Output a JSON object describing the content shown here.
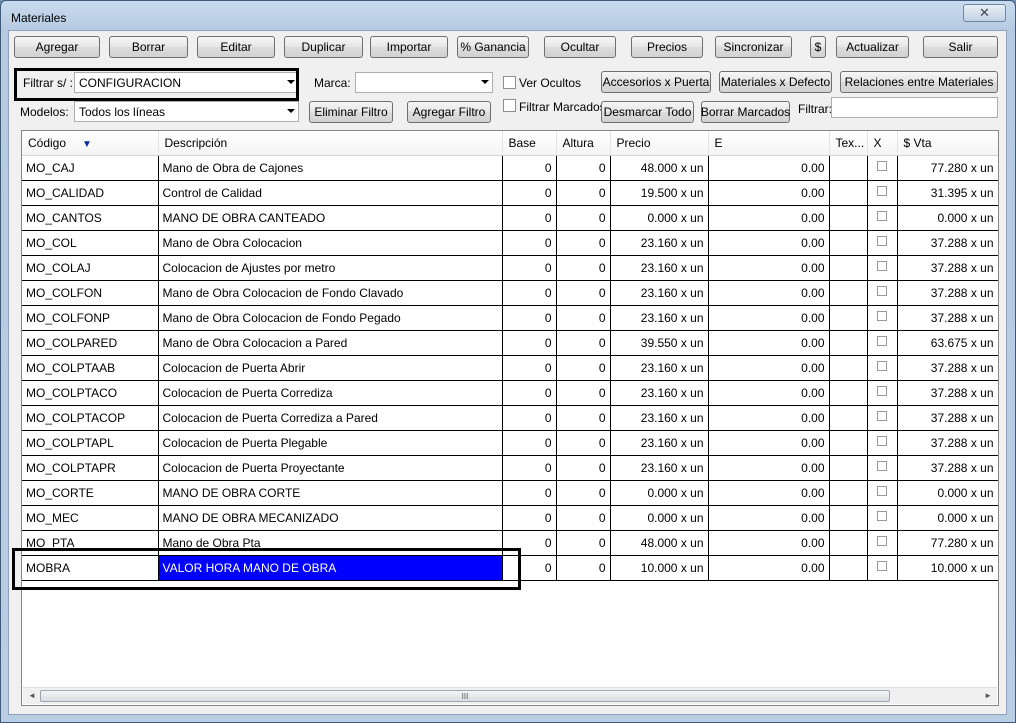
{
  "window": {
    "title": "Materiales",
    "close_glyph": "✕"
  },
  "toolbar": {
    "buttons": [
      "Agregar",
      "Borrar",
      "Editar",
      "Duplicar",
      "Importar",
      "% Ganancia",
      "Ocultar",
      "Precios",
      "Sincronizar",
      "$",
      "Actualizar",
      "Salir"
    ]
  },
  "filters": {
    "filtrar_label": "Filtrar s/ :",
    "filtrar_value": "CONFIGURACION",
    "marca_label": "Marca:",
    "marca_value": "",
    "modelos_label": "Modelos:",
    "modelos_value": "Todos los líneas",
    "ver_ocultos": "Ver Ocultos",
    "filtrar_marcados": "Filtrar Marcados",
    "eliminar_filtro": "Eliminar Filtro",
    "agregar_filtro": "Agregar Filtro",
    "accesorios_puerta": "Accesorios x Puerta",
    "materiales_defecto": "Materiales x Defecto",
    "relaciones": "Relaciones entre Materiales",
    "desmarcar_todo": "Desmarcar Todo",
    "borrar_marcados": "Borrar Marcados",
    "filtrar_text_label": "Filtrar:"
  },
  "table": {
    "headers": [
      "Código",
      "Descripción",
      "Base",
      "Altura",
      "Precio",
      "E",
      "Tex...",
      "X",
      "$ Vta"
    ],
    "sort_glyph": "▼",
    "rows": [
      {
        "codigo": "MO_CAJ",
        "descripcion": "Mano de Obra de Cajones",
        "base": "0",
        "altura": "0",
        "precio": "48.000 x un",
        "e": "0.00",
        "vta": "77.280 x un"
      },
      {
        "codigo": "MO_CALIDAD",
        "descripcion": "Control de Calidad",
        "base": "0",
        "altura": "0",
        "precio": "19.500 x un",
        "e": "0.00",
        "vta": "31.395 x un"
      },
      {
        "codigo": "MO_CANTOS",
        "descripcion": "MANO DE OBRA CANTEADO",
        "base": "0",
        "altura": "0",
        "precio": "0.000 x un",
        "e": "0.00",
        "vta": "0.000 x un"
      },
      {
        "codigo": "MO_COL",
        "descripcion": "Mano de Obra Colocacion",
        "base": "0",
        "altura": "0",
        "precio": "23.160 x un",
        "e": "0.00",
        "vta": "37.288 x un"
      },
      {
        "codigo": "MO_COLAJ",
        "descripcion": "Colocacion de Ajustes por metro",
        "base": "0",
        "altura": "0",
        "precio": "23.160 x un",
        "e": "0.00",
        "vta": "37.288 x un"
      },
      {
        "codigo": "MO_COLFON",
        "descripcion": "Mano de Obra Colocacion de Fondo Clavado",
        "base": "0",
        "altura": "0",
        "precio": "23.160 x un",
        "e": "0.00",
        "vta": "37.288 x un"
      },
      {
        "codigo": "MO_COLFONP",
        "descripcion": "Mano de Obra Colocacion de Fondo Pegado",
        "base": "0",
        "altura": "0",
        "precio": "23.160 x un",
        "e": "0.00",
        "vta": "37.288 x un"
      },
      {
        "codigo": "MO_COLPARED",
        "descripcion": "Mano de Obra Colocacion a Pared",
        "base": "0",
        "altura": "0",
        "precio": "39.550 x un",
        "e": "0.00",
        "vta": "63.675 x un"
      },
      {
        "codigo": "MO_COLPTAAB",
        "descripcion": "Colocacion de Puerta Abrir",
        "base": "0",
        "altura": "0",
        "precio": "23.160 x un",
        "e": "0.00",
        "vta": "37.288 x un"
      },
      {
        "codigo": "MO_COLPTACO",
        "descripcion": "Colocacion de Puerta Corrediza",
        "base": "0",
        "altura": "0",
        "precio": "23.160 x un",
        "e": "0.00",
        "vta": "37.288 x un"
      },
      {
        "codigo": "MO_COLPTACOP",
        "descripcion": "Colocacion de Puerta Corrediza a Pared",
        "base": "0",
        "altura": "0",
        "precio": "23.160 x un",
        "e": "0.00",
        "vta": "37.288 x un"
      },
      {
        "codigo": "MO_COLPTAPL",
        "descripcion": "Colocacion de Puerta Plegable",
        "base": "0",
        "altura": "0",
        "precio": "23.160 x un",
        "e": "0.00",
        "vta": "37.288 x un"
      },
      {
        "codigo": "MO_COLPTAPR",
        "descripcion": "Colocacion de Puerta Proyectante",
        "base": "0",
        "altura": "0",
        "precio": "23.160 x un",
        "e": "0.00",
        "vta": "37.288 x un"
      },
      {
        "codigo": "MO_CORTE",
        "descripcion": "MANO DE OBRA CORTE",
        "base": "0",
        "altura": "0",
        "precio": "0.000 x un",
        "e": "0.00",
        "vta": "0.000 x un"
      },
      {
        "codigo": "MO_MEC",
        "descripcion": "MANO DE OBRA MECANIZADO",
        "base": "0",
        "altura": "0",
        "precio": "0.000 x un",
        "e": "0.00",
        "vta": "0.000 x un"
      },
      {
        "codigo": "MO_PTA",
        "descripcion": "Mano de Obra Pta",
        "base": "0",
        "altura": "0",
        "precio": "48.000 x un",
        "e": "0.00",
        "vta": "77.280 x un"
      },
      {
        "codigo": "MOBRA",
        "descripcion": "VALOR HORA MANO DE OBRA",
        "base": "0",
        "altura": "0",
        "precio": "10.000 x un",
        "e": "0.00",
        "vta": "10.000 x un",
        "selected": true
      }
    ]
  },
  "scrollbar": {
    "grip_glyph": "III",
    "left_glyph": "◄",
    "right_glyph": "►"
  },
  "colors": {
    "selection": "#0000ff",
    "highlight_frame": "#000000"
  }
}
